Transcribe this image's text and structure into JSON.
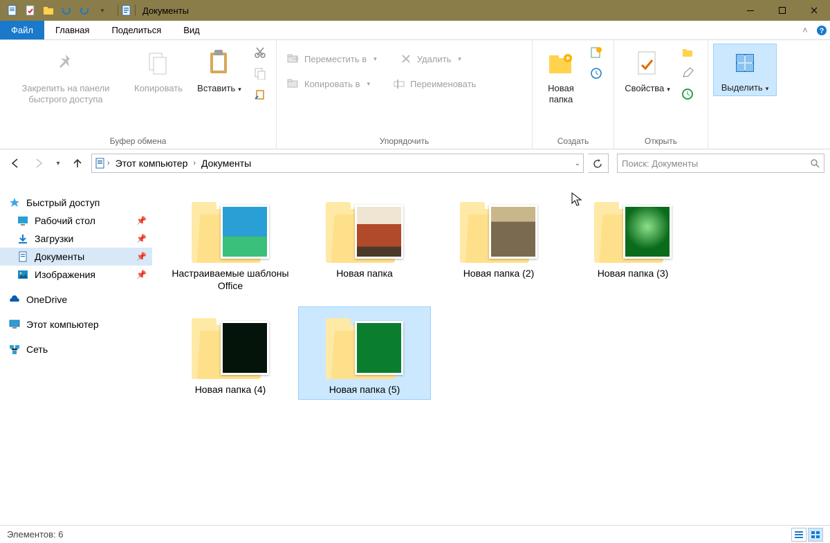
{
  "title": "Документы",
  "ribbon": {
    "tabs": {
      "file": "Файл",
      "home": "Главная",
      "share": "Поделиться",
      "view": "Вид"
    },
    "groups": {
      "clipboard": {
        "label": "Буфер обмена",
        "pin": "Закрепить на панели быстрого доступа",
        "copy": "Копировать",
        "paste": "Вставить"
      },
      "organize": {
        "label": "Упорядочить",
        "move_to": "Переместить в",
        "copy_to": "Копировать в",
        "delete": "Удалить",
        "rename": "Переименовать"
      },
      "new": {
        "label": "Создать",
        "new_folder": "Новая папка"
      },
      "open": {
        "label": "Открыть",
        "properties": "Свойства"
      },
      "select": {
        "label": "",
        "select": "Выделить"
      }
    }
  },
  "breadcrumb": {
    "root": "Этот компьютер",
    "current": "Документы"
  },
  "search": {
    "placeholder": "Поиск: Документы"
  },
  "sidebar": {
    "quick_access": "Быстрый доступ",
    "items": [
      {
        "label": "Рабочий стол",
        "pinned": true
      },
      {
        "label": "Загрузки",
        "pinned": true
      },
      {
        "label": "Документы",
        "pinned": true,
        "selected": true
      },
      {
        "label": "Изображения",
        "pinned": true
      }
    ],
    "onedrive": "OneDrive",
    "this_pc": "Этот компьютер",
    "network": "Сеть"
  },
  "items": [
    {
      "label": "Настраиваемые шаблоны Office",
      "preview_color": "#2a9fd6",
      "selected": false
    },
    {
      "label": "Новая папка",
      "preview_color": "#b04a2a",
      "selected": false
    },
    {
      "label": "Новая папка (2)",
      "preview_color": "#7a6a4f",
      "selected": false
    },
    {
      "label": "Новая папка (3)",
      "preview_color": "#0a6b1c",
      "selected": false
    },
    {
      "label": "Новая папка (4)",
      "preview_color": "#05140a",
      "selected": false
    },
    {
      "label": "Новая папка (5)",
      "preview_color": "#0b7d2e",
      "selected": true
    }
  ],
  "status": {
    "count_label": "Элементов:",
    "count": "6"
  }
}
